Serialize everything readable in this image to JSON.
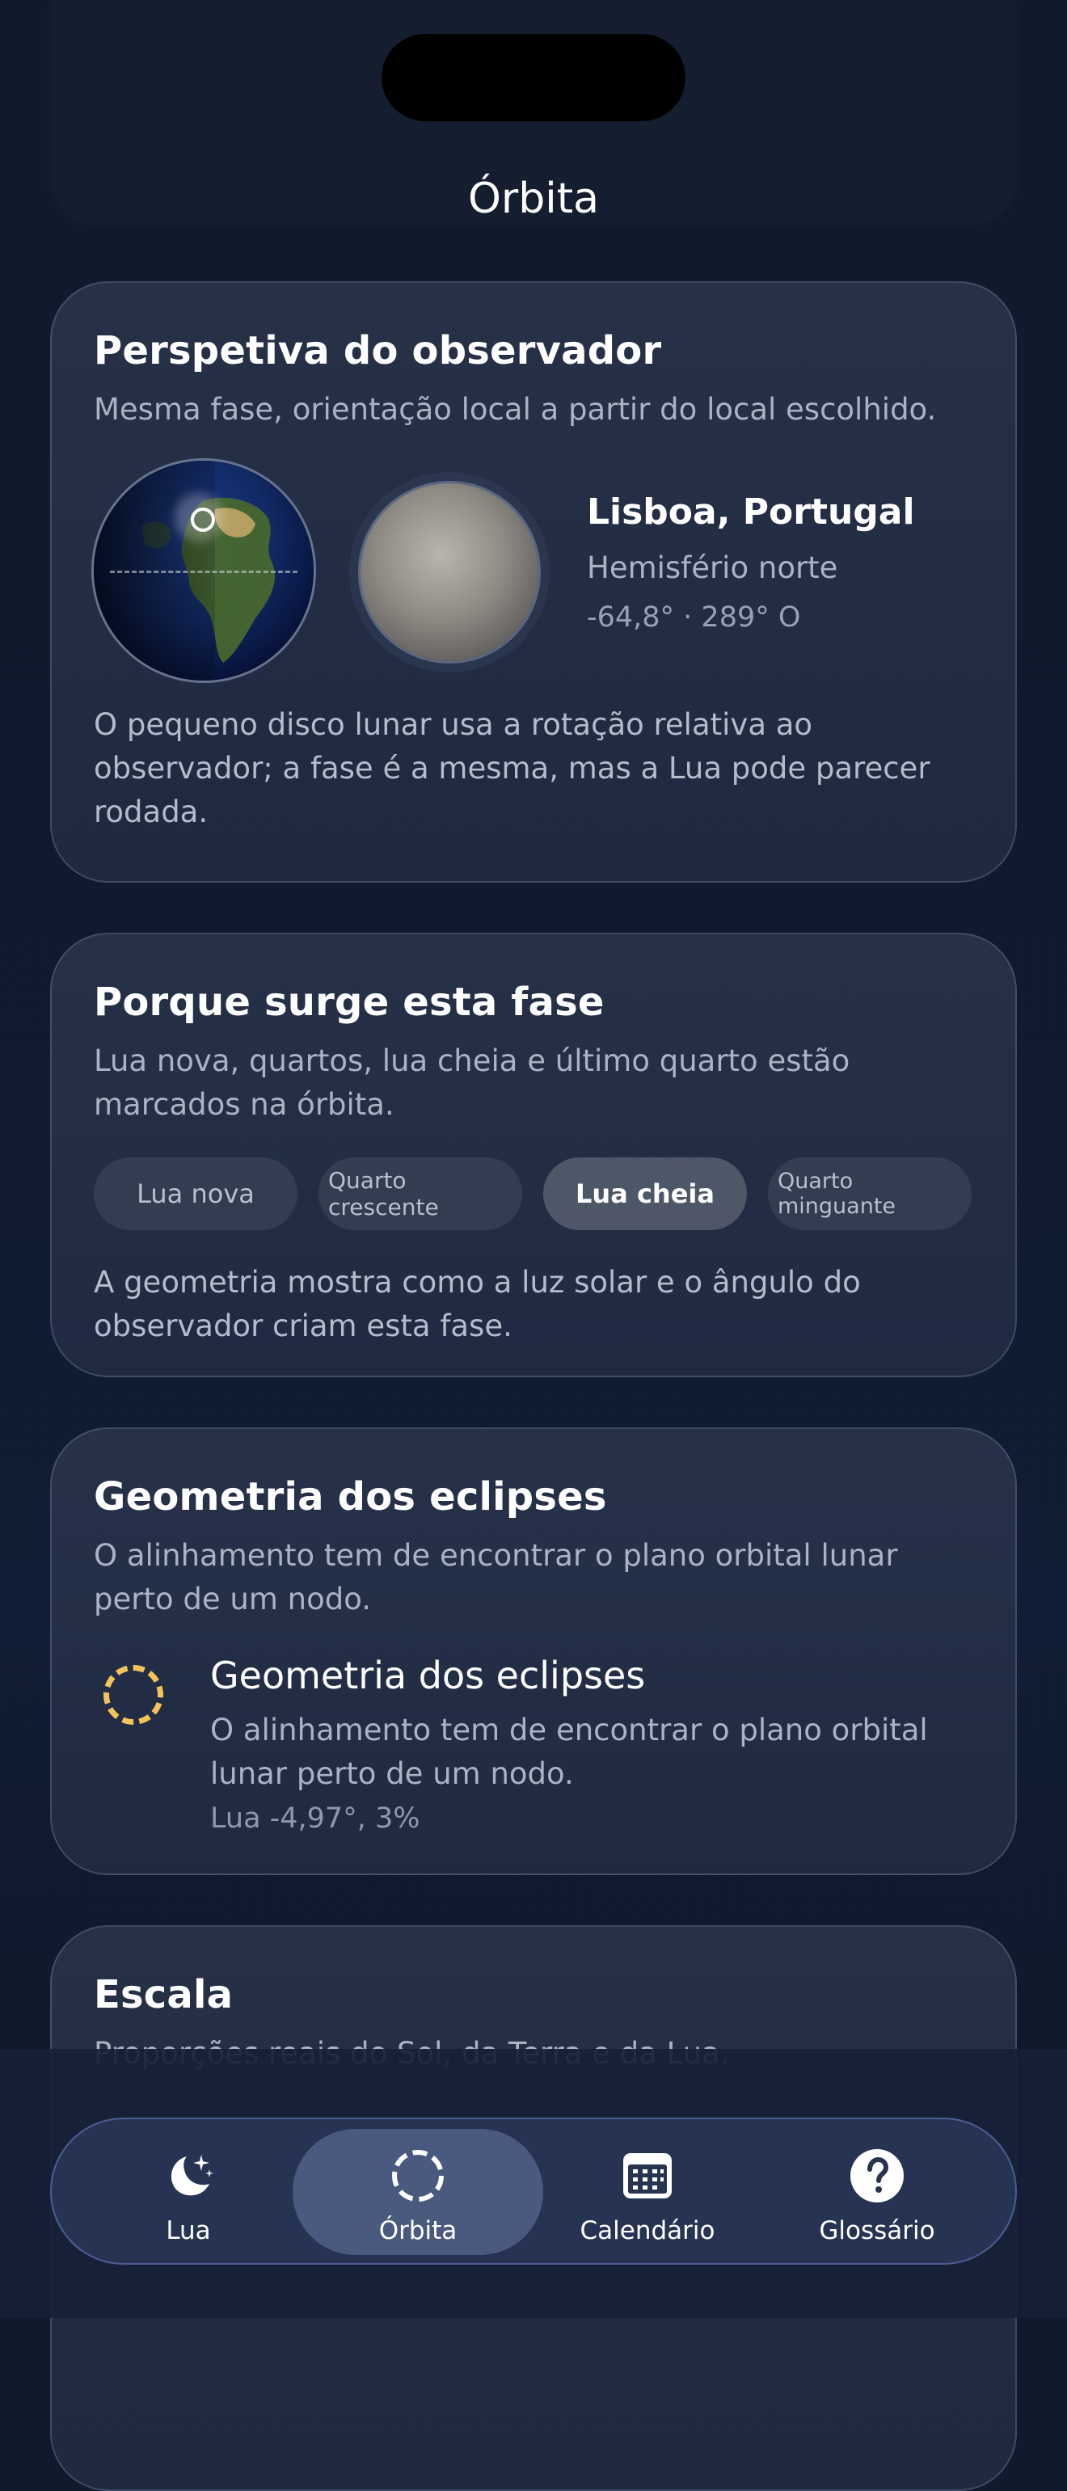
{
  "header": {
    "title": "Órbita"
  },
  "observer": {
    "title": "Perspetiva do observador",
    "subtitle": "Mesma fase, orientação local a partir do local escolhido.",
    "location_name": "Lisboa, Portugal",
    "hemisphere": "Hemisfério norte",
    "coordinates": "-64,8° · 289° O",
    "description": "O pequeno disco lunar usa a rotação relativa ao observador; a fase é a mesma, mas a Lua pode parecer rodada."
  },
  "phase": {
    "title": "Porque surge esta fase",
    "subtitle": "Lua nova, quartos, lua cheia e último quarto estão marcados na órbita.",
    "chips": [
      {
        "label": "Lua nova",
        "selected": false
      },
      {
        "label": "Quarto crescente",
        "selected": false
      },
      {
        "label": "Lua cheia",
        "selected": true
      },
      {
        "label": "Quarto minguante",
        "selected": false
      }
    ],
    "description": "A geometria mostra como a luz solar e o ângulo do observador criam esta fase."
  },
  "eclipse": {
    "title": "Geometria dos eclipses",
    "subtitle": "O alinhamento tem de encontrar o plano orbital lunar perto de um nodo.",
    "item_title": "Geometria dos eclipses",
    "item_description": "O alinhamento tem de encontrar o plano orbital lunar perto de um nodo.",
    "item_value": "Lua -4,97°, 3%",
    "accent_color": "#f4c45a"
  },
  "scale": {
    "title": "Escala",
    "subtitle": "Proporções reais do Sol, da Terra e da Lua."
  },
  "tabbar": {
    "tabs": [
      {
        "label": "Lua",
        "icon": "moon-stars-icon",
        "active": false
      },
      {
        "label": "Órbita",
        "icon": "orbit-dashed-circle-icon",
        "active": true
      },
      {
        "label": "Calendário",
        "icon": "calendar-icon",
        "active": false
      },
      {
        "label": "Glossário",
        "icon": "question-mark-icon",
        "active": false
      }
    ]
  }
}
